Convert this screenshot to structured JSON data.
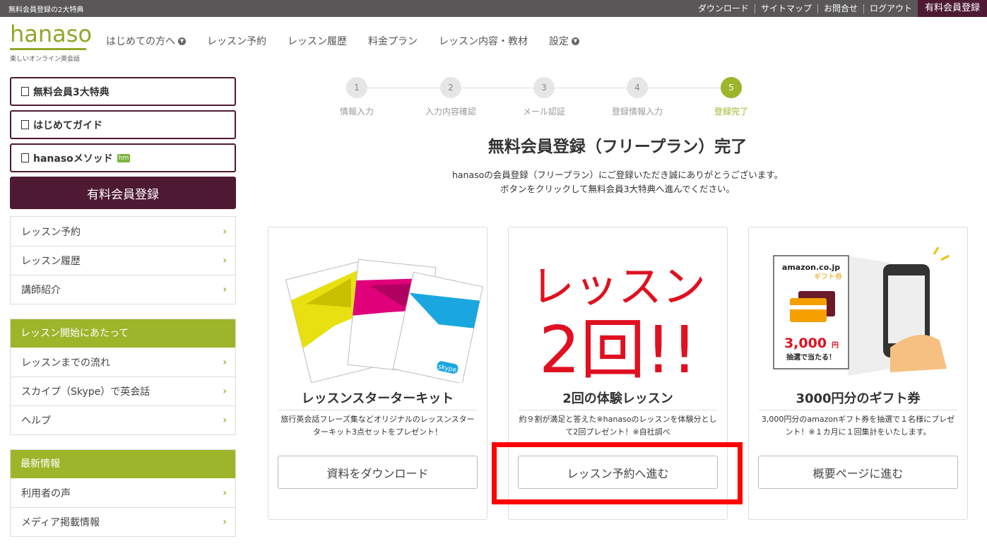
{
  "topbar": {
    "promo": "無料会員登録の2大特典",
    "links": [
      "ダウンロード",
      "サイトマップ",
      "お問合せ",
      "ログアウト"
    ],
    "paid": "有料会員登録"
  },
  "logo": {
    "word": "hanaso",
    "tagline": "楽しいオンライン英会話"
  },
  "nav": [
    "はじめての方へ",
    "レッスン予約",
    "レッスン履歴",
    "料金プラン",
    "レッスン内容・教材",
    "設定"
  ],
  "sidebar": {
    "outline": [
      "無料会員3大特典",
      "はじめてガイド",
      "hanasoメソッド"
    ],
    "hm_badge": "hm",
    "paid_button": "有料会員登録",
    "menu1": [
      "レッスン予約",
      "レッスン履歴",
      "講師紹介"
    ],
    "menu2_head": "レッスン開始にあたって",
    "menu2": [
      "レッスンまでの流れ",
      "スカイプ（Skype）で英会話",
      "ヘルプ"
    ],
    "menu3_head": "最新情報",
    "menu3": [
      "利用者の声",
      "メディア掲載情報"
    ]
  },
  "steps": [
    {
      "num": "1",
      "label": "情報入力"
    },
    {
      "num": "2",
      "label": "入力内容確認"
    },
    {
      "num": "3",
      "label": "メール認証"
    },
    {
      "num": "4",
      "label": "登録情報入力"
    },
    {
      "num": "5",
      "label": "登録完了"
    }
  ],
  "title": "無料会員登録（フリープラン）完了",
  "desc1": "hanasoの会員登録（フリープラン）にご登録いただき誠にありがとうございます。",
  "desc2": "ボタンをクリックして無料会員3大特典へ進んでください。",
  "cards": [
    {
      "title": "レッスンスターターキット",
      "text": "旅行英会話フレーズ集などオリジナルのレッスンスターターキット3点セットをプレゼント！",
      "button": "資料をダウンロード",
      "img_text": "skype"
    },
    {
      "title": "2回の体験レッスン",
      "text": "約９割が満足と答えた※hanasoのレッスンを体験分として2回プレゼント！※自社調べ",
      "button": "レッスン予約へ進む",
      "img_line1": "レッスン",
      "img_line2": "2回!!"
    },
    {
      "title": "3000円分のギフト券",
      "text": "3,000円分のamazonギフト券を抽選で１名様にプレゼント！※１カ月に１回集計をいたします。",
      "button": "概要ページに進む",
      "img_brand": "amazon.co.jp",
      "img_gift": "ギフト券",
      "img_amount": "3,000",
      "img_yen": "円",
      "img_lottery": "抽選で当たる！"
    }
  ],
  "colors": {
    "brand_green": "#9db52a",
    "brand_purple": "#4e1a33",
    "highlight": "#ff0000"
  }
}
